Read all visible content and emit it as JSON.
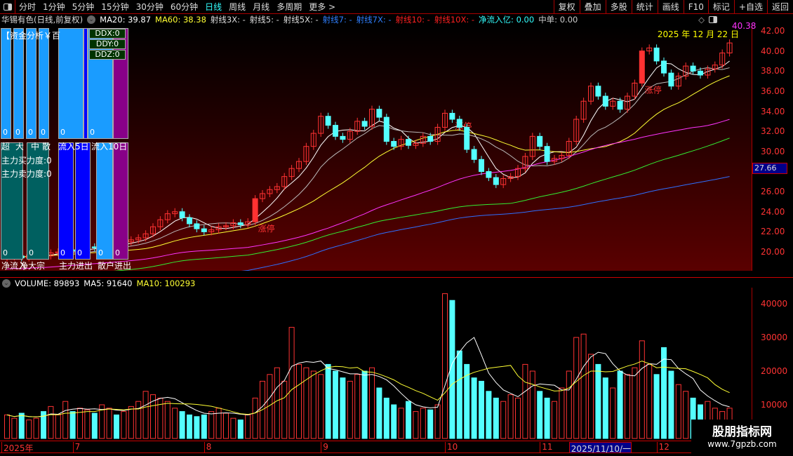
{
  "topbar": {
    "tabs": [
      "分时",
      "1分钟",
      "5分钟",
      "15分钟",
      "30分钟",
      "60分钟",
      "日线",
      "周线",
      "月线",
      "多周期",
      "更多 >"
    ],
    "active": "日线",
    "buttons": [
      "复权",
      "叠加",
      "多股",
      "统计",
      "画线",
      "F10",
      "标记",
      "+自选",
      "返回"
    ]
  },
  "info": {
    "title": "华锡有色(日线,前复权)",
    "ma20": "MA20: 39.87",
    "ma60": "MA60: 38.38",
    "items": [
      {
        "t": "射线3X: -",
        "c": "#dddddd"
      },
      {
        "t": "射线5: -",
        "c": "#dddddd"
      },
      {
        "t": "射线5X: -",
        "c": "#dddddd"
      },
      {
        "t": "射线7: -",
        "c": "#2f7fff"
      },
      {
        "t": "射线7X: -",
        "c": "#2f7fff"
      },
      {
        "t": "射线10: -",
        "c": "#ff2020"
      },
      {
        "t": "射线10X: -",
        "c": "#ff2020"
      },
      {
        "t": "净流入亿: 0.00",
        "c": "#33ffff"
      },
      {
        "t": "中单: 0.00",
        "c": "#cccccc"
      }
    ]
  },
  "chart_data": {
    "type": "candlestick",
    "price_axis": {
      "ticks": [
        "42.00",
        "40.00",
        "38.00",
        "36.00",
        "34.00",
        "32.00",
        "30.00",
        "26.00",
        "24.00",
        "22.00",
        "20.00"
      ],
      "range": [
        18.9,
        42.3
      ],
      "current": "27.66"
    },
    "date_label": "2025 年 12 月 22 日",
    "last_price": "40.38",
    "limit_up_label": "涨停",
    "limit_up_index": [
      34,
      61,
      87
    ],
    "colors": {
      "up": "#ff3232",
      "down": "#54ffff",
      "ma5": "#ffffff",
      "ma10": "#bbbbbb",
      "ma20": "#ffff33",
      "ma60": "#ff33ff",
      "ma90": "#33ee33",
      "ma250": "#2f6fff"
    },
    "close": [
      19.5,
      19.6,
      19.4,
      19.7,
      19.8,
      19.6,
      19.9,
      20.0,
      20.2,
      20.1,
      20.3,
      20.5,
      20.4,
      20.6,
      20.8,
      20.7,
      21.0,
      21.2,
      21.4,
      21.8,
      22.5,
      23.2,
      23.8,
      24.0,
      23.4,
      22.8,
      22.3,
      22.0,
      22.2,
      22.5,
      22.6,
      22.9,
      22.7,
      23.0,
      25.3,
      25.8,
      26.2,
      26.5,
      27.5,
      28.3,
      29.0,
      30.5,
      31.8,
      33.5,
      32.6,
      31.5,
      31.2,
      32.0,
      33.0,
      32.5,
      34.2,
      33.4,
      31.0,
      30.5,
      31.2,
      30.6,
      30.8,
      31.5,
      31.0,
      32.4,
      33.8,
      33.2,
      32.4,
      30.2,
      29.2,
      28.0,
      27.4,
      26.7,
      27.3,
      27.5,
      28.3,
      29.5,
      31.5,
      30.5,
      29.0,
      29.3,
      29.6,
      31.0,
      33.2,
      35.0,
      36.5,
      35.5,
      34.5,
      35.0,
      34.2,
      35.5,
      36.8,
      40.0,
      40.3,
      39.0,
      37.8,
      36.5,
      37.5,
      38.5,
      38.0,
      37.6,
      38.2,
      38.6,
      39.8,
      40.8
    ],
    "volume": [
      7000,
      6000,
      7500,
      5500,
      6000,
      8000,
      9500,
      7000,
      11000,
      8000,
      9000,
      8500,
      7500,
      10000,
      9000,
      7000,
      8000,
      9500,
      11000,
      14000,
      13000,
      12000,
      11000,
      9000,
      8000,
      7000,
      6500,
      7000,
      8000,
      9000,
      7500,
      6000,
      5500,
      7000,
      12000,
      17000,
      19000,
      21000,
      17000,
      33000,
      22000,
      21000,
      20000,
      19000,
      22000,
      20000,
      18000,
      17000,
      19000,
      20000,
      21000,
      15000,
      12000,
      10000,
      9000,
      11000,
      8000,
      9000,
      8500,
      10000,
      43000,
      41000,
      26000,
      22000,
      18000,
      17000,
      14000,
      12000,
      11000,
      13000,
      12000,
      22000,
      20000,
      14000,
      12000,
      11000,
      15000,
      20000,
      30000,
      31000,
      25000,
      22000,
      18000,
      15000,
      20000,
      19000,
      21000,
      29000,
      22000,
      19000,
      27000,
      20000,
      16000,
      14000,
      12000,
      10000,
      11000,
      9000,
      8000,
      9000
    ],
    "volume_axis": {
      "ticks": [
        "40000",
        "30000",
        "20000",
        "10000"
      ],
      "max": 46000
    },
    "dates": [
      {
        "t": "2025年",
        "i": 0
      },
      {
        "t": "7",
        "i": 9
      },
      {
        "t": "8",
        "i": 27
      },
      {
        "t": "9",
        "i": 43
      },
      {
        "t": "10",
        "i": 60
      },
      {
        "t": "11",
        "i": 73
      },
      {
        "t": "2025/11/10/一",
        "i": 77,
        "hl": true
      },
      {
        "t": "12",
        "i": 89
      }
    ]
  },
  "volume": {
    "label": "VOLUME: 89893",
    "ma5": "MA5: 91640",
    "ma10": "MA10: 100293"
  },
  "panel": {
    "title": "【资金分析￥百",
    "zeros": "0",
    "labels": [
      "超",
      "大",
      "中",
      "散",
      "流入5日",
      "流入10日"
    ],
    "buy": "主力买力度:0",
    "sell": "主力卖力度:0",
    "ddx": "DDX:0",
    "ddy": "DDY:0",
    "ddz": "DDZ:0",
    "bottom": [
      "净流入",
      "净大宗",
      "主力进出",
      "散户进出"
    ]
  },
  "watermark": {
    "name": "股朋指标网",
    "url": "www.7gpzb.com"
  }
}
